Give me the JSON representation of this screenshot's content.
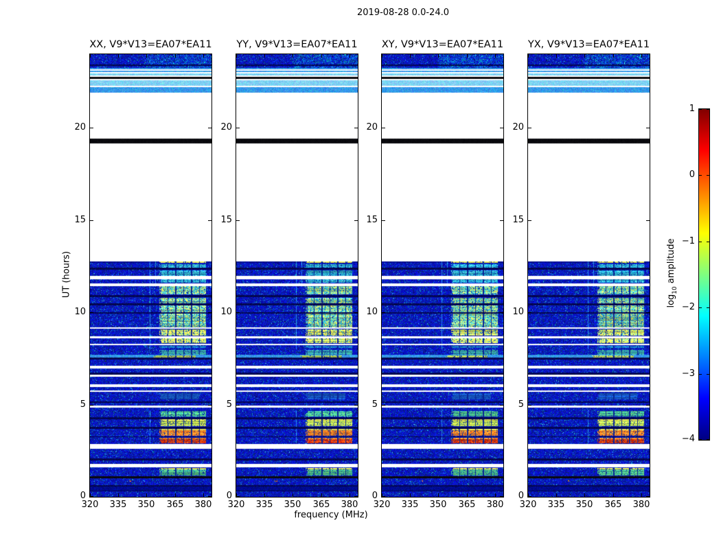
{
  "title": "2019-08-28 0.0-24.0",
  "colorbar_label": {
    "prefix": "log",
    "sub": "10",
    "suffix": " amplitude"
  },
  "chart_data": {
    "type": "heatmap",
    "subtype": "dynamic-spectrum-waterfall",
    "title": "2019-08-28 0.0-24.0",
    "xlabel": "frequency (MHz)",
    "ylabel": "UT (hours)",
    "panels": [
      "XX, V9*V13=EA07*EA11",
      "YY, V9*V13=EA07*EA11",
      "XY, V9*V13=EA07*EA11",
      "YX, V9*V13=EA07*EA11"
    ],
    "x_ticks": [
      320,
      335,
      350,
      365,
      380
    ],
    "y_ticks": [
      0,
      5,
      10,
      15,
      20
    ],
    "x_range_mhz": [
      320,
      384.4
    ],
    "y_range_hours": [
      0,
      24
    ],
    "colorbar": {
      "label": "log10 amplitude",
      "ticks": [
        1,
        0,
        -1,
        -2,
        -3,
        -4
      ],
      "range": [
        -4,
        1
      ],
      "colormap": "jet"
    },
    "amplitude_key_log10": {
      "noise": -3.5,
      "noiseb": -3.4,
      "noise2": -3.8,
      "dark": -3.9,
      "light": -2.6,
      "lighter": -2.2,
      "black": "flagged",
      "white": "no data"
    },
    "time_bands": [
      [
        23.45,
        24.0,
        "noiseb"
      ],
      [
        23.36,
        23.45,
        "dark"
      ],
      [
        23.26,
        23.36,
        "noiseb"
      ],
      [
        23.18,
        23.26,
        "light"
      ],
      [
        23.12,
        23.18,
        "white"
      ],
      [
        23.02,
        23.12,
        "light"
      ],
      [
        22.95,
        23.02,
        "white"
      ],
      [
        22.86,
        22.95,
        "lighter"
      ],
      [
        22.78,
        22.86,
        "white"
      ],
      [
        22.66,
        22.78,
        "black"
      ],
      [
        22.6,
        22.66,
        "white"
      ],
      [
        22.3,
        22.6,
        "lighter"
      ],
      [
        22.22,
        22.3,
        "white"
      ],
      [
        21.92,
        22.22,
        "light"
      ],
      [
        19.42,
        21.92,
        "white"
      ],
      [
        19.15,
        19.42,
        "black"
      ],
      [
        12.78,
        19.15,
        "white"
      ],
      [
        12.68,
        12.78,
        "noise2"
      ],
      [
        12.44,
        12.68,
        "noise"
      ],
      [
        12.3,
        12.44,
        "dark"
      ],
      [
        11.98,
        12.3,
        "noise"
      ],
      [
        11.8,
        11.98,
        "white"
      ],
      [
        11.58,
        11.8,
        "noise"
      ],
      [
        11.44,
        11.58,
        "white"
      ],
      [
        10.95,
        11.44,
        "noise"
      ],
      [
        10.82,
        10.95,
        "dark"
      ],
      [
        10.48,
        10.82,
        "noise"
      ],
      [
        10.4,
        10.48,
        "dark"
      ],
      [
        10.02,
        10.4,
        "noise"
      ],
      [
        9.95,
        10.02,
        "dark"
      ],
      [
        9.18,
        9.95,
        "noise"
      ],
      [
        9.1,
        9.18,
        "white"
      ],
      [
        8.72,
        9.1,
        "noise"
      ],
      [
        8.6,
        8.72,
        "white"
      ],
      [
        8.3,
        8.6,
        "noise"
      ],
      [
        8.22,
        8.3,
        "white"
      ],
      [
        7.7,
        8.22,
        "noise"
      ],
      [
        7.55,
        7.7,
        "light"
      ],
      [
        7.44,
        7.55,
        "dark"
      ],
      [
        7.12,
        7.44,
        "noise"
      ],
      [
        6.96,
        7.12,
        "white"
      ],
      [
        6.75,
        6.96,
        "noise"
      ],
      [
        6.64,
        6.75,
        "dark"
      ],
      [
        6.5,
        6.64,
        "white"
      ],
      [
        6.12,
        6.5,
        "noise"
      ],
      [
        5.94,
        6.12,
        "white"
      ],
      [
        5.76,
        5.94,
        "noise"
      ],
      [
        5.68,
        5.76,
        "white"
      ],
      [
        5.18,
        5.68,
        "noise"
      ],
      [
        5.08,
        5.18,
        "dark"
      ],
      [
        4.95,
        5.08,
        "noise"
      ],
      [
        4.83,
        4.95,
        "white"
      ],
      [
        4.3,
        4.83,
        "noise"
      ],
      [
        4.22,
        4.3,
        "dark"
      ],
      [
        3.8,
        4.22,
        "noise"
      ],
      [
        3.7,
        3.8,
        "dark"
      ],
      [
        3.28,
        3.7,
        "noise"
      ],
      [
        3.22,
        3.28,
        "dark"
      ],
      [
        2.85,
        3.22,
        "noise"
      ],
      [
        2.6,
        2.85,
        "white"
      ],
      [
        2.08,
        2.6,
        "noise"
      ],
      [
        1.98,
        2.08,
        "dark"
      ],
      [
        1.78,
        1.98,
        "noise"
      ],
      [
        1.6,
        1.78,
        "white"
      ],
      [
        1.12,
        1.6,
        "noise"
      ],
      [
        1.0,
        1.12,
        "black"
      ],
      [
        0.64,
        1.0,
        "noise"
      ],
      [
        0.56,
        0.64,
        "dark"
      ],
      [
        0.34,
        0.56,
        "noise2"
      ],
      [
        0.28,
        0.34,
        "dark"
      ],
      [
        0.0,
        0.28,
        "noise"
      ]
    ],
    "features": [
      {
        "palette": "yellow",
        "t": [
          12.68,
          12.78
        ],
        "f": [
          356.8,
          381.6
        ]
      },
      {
        "palette": "cyan",
        "t": [
          12.44,
          12.62
        ],
        "f": [
          356.8,
          381.6
        ]
      },
      {
        "palette": "cyan",
        "t": [
          12.0,
          12.28
        ],
        "f": [
          356.8,
          381.6
        ]
      },
      {
        "palette": "cyan",
        "t": [
          11.6,
          11.78
        ],
        "f": [
          356.8,
          381.6
        ]
      },
      {
        "palette": "cyanyellow",
        "t": [
          10.97,
          11.42
        ],
        "f": [
          356.8,
          381.6
        ]
      },
      {
        "palette": "cyanyellow",
        "t": [
          10.5,
          10.8
        ],
        "f": [
          356.8,
          381.6
        ]
      },
      {
        "palette": "cyanyellow",
        "t": [
          9.2,
          10.38
        ],
        "f": [
          356.8,
          381.6
        ]
      },
      {
        "palette": "yellowcyan",
        "t": [
          8.74,
          9.08
        ],
        "f": [
          356.8,
          381.6
        ]
      },
      {
        "palette": "yellowcyan",
        "t": [
          8.32,
          8.58
        ],
        "f": [
          356.8,
          381.6
        ]
      },
      {
        "palette": "cyanfaint",
        "t": [
          8.07,
          8.2
        ],
        "f": [
          356.8,
          381.6
        ]
      },
      {
        "palette": "greenfaint",
        "t": [
          7.72,
          7.95
        ],
        "f": [
          356.8,
          381.6
        ]
      },
      {
        "palette": "yellowgreen",
        "t": [
          7.57,
          7.68
        ],
        "f": [
          354.0,
          376.0
        ]
      },
      {
        "palette": "bluefaint",
        "t": [
          5.3,
          5.6
        ],
        "f": [
          357.0,
          378.0
        ]
      },
      {
        "palette": "green",
        "t": [
          4.36,
          4.66
        ],
        "f": [
          356.8,
          381.6
        ]
      },
      {
        "palette": "yellow",
        "t": [
          4.12,
          4.2
        ],
        "f": [
          356.8,
          381.6
        ]
      },
      {
        "palette": "yellowgreen",
        "t": [
          3.84,
          4.12
        ],
        "f": [
          356.8,
          381.6
        ]
      },
      {
        "palette": "yellow",
        "t": [
          3.6,
          3.68
        ],
        "f": [
          356.8,
          381.6
        ]
      },
      {
        "palette": "orange",
        "t": [
          3.32,
          3.6
        ],
        "f": [
          356.8,
          381.6
        ]
      },
      {
        "palette": "orange",
        "t": [
          3.14,
          3.21
        ],
        "f": [
          356.8,
          381.6
        ]
      },
      {
        "palette": "red",
        "t": [
          2.9,
          3.14
        ],
        "f": [
          356.8,
          381.6
        ]
      },
      {
        "palette": "yellow",
        "t": [
          1.5,
          1.58
        ],
        "f": [
          356.8,
          381.6
        ]
      },
      {
        "palette": "green",
        "t": [
          1.15,
          1.5
        ],
        "f": [
          356.8,
          381.6
        ]
      },
      {
        "palette": "orangedot",
        "t": [
          0.8,
          0.9
        ],
        "f": [
          340.5,
          342.0
        ]
      }
    ],
    "feature_column_separators_mhz": [
      361.3,
      365.5,
      369.7,
      373.9,
      378.1
    ],
    "vertical_lines": [
      {
        "f": 351.8,
        "t": [
          8.0,
          12.78
        ]
      },
      {
        "f": 354.6,
        "t": [
          11.4,
          12.78
        ]
      },
      {
        "f": 351.8,
        "t": [
          2.9,
          4.7
        ]
      }
    ]
  },
  "render": {
    "palettes": {
      "cyan": [
        "#18a0cc",
        "#2cb6da",
        "#44c8e2",
        "#20aad4",
        "#60d8d8",
        "#1490c4"
      ],
      "cyanfaint": [
        "#1472c0",
        "#1a84c8",
        "#2296d0",
        "#1268b8"
      ],
      "greenfaint": [
        "#2a9ab0",
        "#3aaa9c",
        "#2e8ec0",
        "#46b890"
      ],
      "bluefaint": [
        "#1048b8",
        "#1656c2",
        "#1c64c8"
      ],
      "cyanyellow": [
        "#2cb8d4",
        "#52ccc0",
        "#e8e458",
        "#c4e06c",
        "#34c4dc",
        "#90dc94",
        "#e0ec60",
        "#28acd0"
      ],
      "yellowcyan": [
        "#e6de4e",
        "#eee858",
        "#c0e068",
        "#52c8bc",
        "#dce858",
        "#f0ee6c"
      ],
      "yellow": [
        "#e8e044",
        "#f2ec58",
        "#dcd84a",
        "#f6f06a"
      ],
      "yellowgreen": [
        "#b4d84e",
        "#cce258",
        "#92cc66",
        "#e2e850"
      ],
      "green": [
        "#3cba8e",
        "#54c488",
        "#2eae9e",
        "#74d072",
        "#46c0a0"
      ],
      "orange": [
        "#ec7018",
        "#f58426",
        "#fa9634",
        "#e25e10",
        "#f8a83e"
      ],
      "red": [
        "#c41e00",
        "#d83008",
        "#ec4c10",
        "#b01000",
        "#f06820"
      ],
      "orangedot": [
        "#f08020",
        "#ffa030"
      ]
    },
    "panel_seeds": [
      11,
      23,
      37,
      53
    ]
  }
}
